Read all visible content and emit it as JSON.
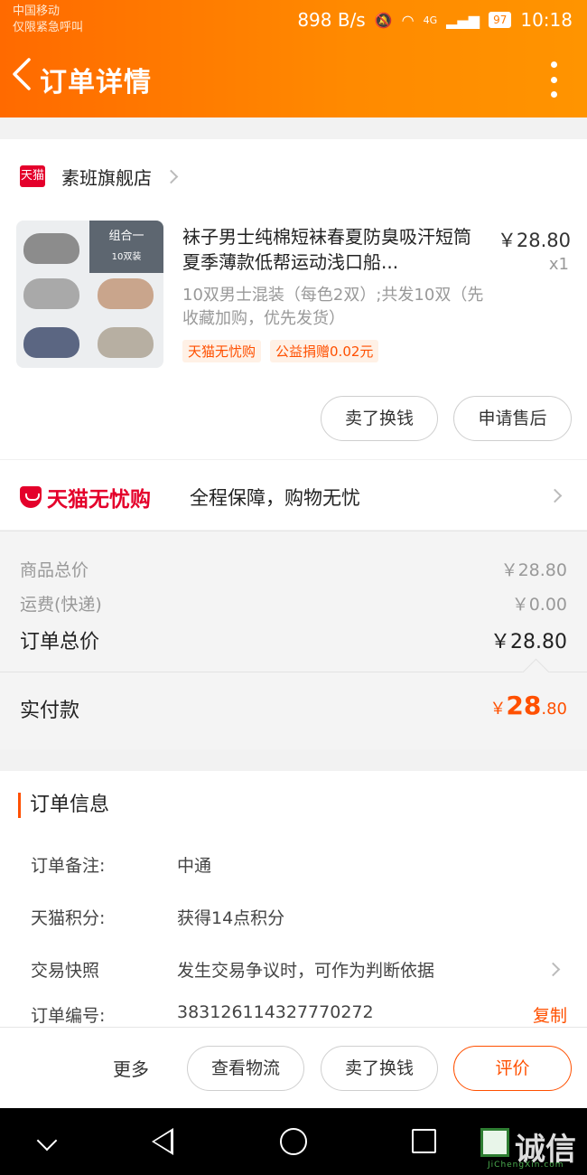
{
  "status_bar": {
    "carrier": "中国移动",
    "emergency": "仅限紧急呼叫",
    "net_speed": "898 B/s",
    "signal": "4G",
    "battery": "97",
    "time": "10:18"
  },
  "header": {
    "title": "订单详情"
  },
  "store": {
    "platform": "天猫",
    "name": "素班旗舰店"
  },
  "product": {
    "title": "袜子男士纯棉短袜春夏防臭吸汗短筒夏季薄款低帮运动浅口船...",
    "price": "￥28.80",
    "quantity": "x1",
    "sku": "10双男士混装（每色2双）;共发10双（先收藏加购，优先发货）",
    "thumb_tag_title": "组合一",
    "thumb_tag_count": "10双装",
    "tags": [
      "天猫无忧购",
      "公益捐赠0.02元"
    ],
    "buttons": {
      "sell": "卖了换钱",
      "after_sale": "申请售后"
    }
  },
  "assurance": {
    "brand": "天猫无忧购",
    "text": "全程保障，购物无忧"
  },
  "summary": {
    "rows": [
      {
        "label": "商品总价",
        "value": "￥28.80"
      },
      {
        "label": "运费(快递)",
        "value": "￥0.00"
      }
    ],
    "total_label": "订单总价",
    "total_value": "￥28.80",
    "paid_label": "实付款",
    "paid_currency": "￥",
    "paid_integer": "28",
    "paid_decimal": ".80"
  },
  "order_info": {
    "title": "订单信息",
    "rows": [
      {
        "key": "订单备注:",
        "value": "中通"
      },
      {
        "key": "天猫积分:",
        "value": "获得14点积分"
      },
      {
        "key": "交易快照",
        "value": "发生交易争议时，可作为判断依据"
      },
      {
        "key": "订单编号:",
        "value": "383126114327770272"
      }
    ],
    "copy_label": "复制"
  },
  "actions": {
    "more": "更多",
    "logistics": "查看物流",
    "sell": "卖了换钱",
    "review": "评价"
  },
  "watermark": {
    "text": "诚信",
    "sub": "JiChengXin.com"
  },
  "colors": {
    "brand_orange": "#ff5000",
    "tmall_red": "#e4002b"
  }
}
